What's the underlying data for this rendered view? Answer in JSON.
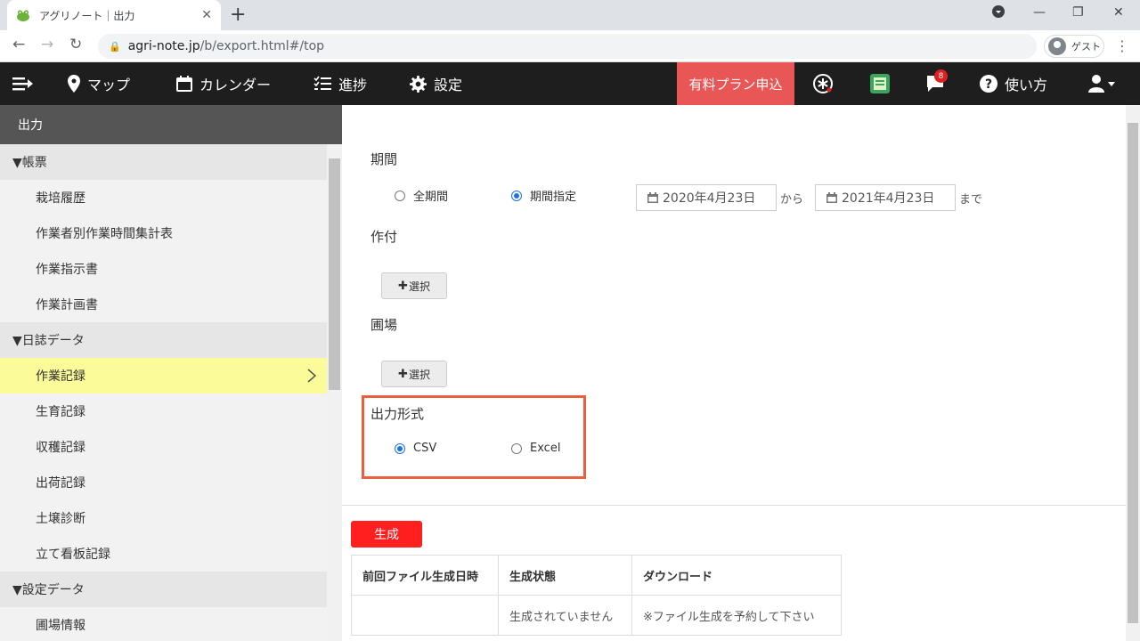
{
  "browser": {
    "tab_title": "アグリノート｜出力",
    "url_host": "agri-note.jp",
    "url_path": "/b/export.html#/top",
    "profile_label": "ゲスト"
  },
  "nav": {
    "map": "マップ",
    "calendar": "カレンダー",
    "progress": "進捗",
    "settings": "設定",
    "paid_plan": "有料プラン申込",
    "notification_count": "8",
    "help": "使い方"
  },
  "sidebar": {
    "header": "出力",
    "groups": [
      {
        "label": "▼帳票",
        "items": [
          "栽培履歴",
          "作業者別作業時間集計表",
          "作業指示書",
          "作業計画書"
        ]
      },
      {
        "label": "▼日誌データ",
        "items": [
          "作業記録",
          "生育記録",
          "収穫記録",
          "出荷記録",
          "土壌診断",
          "立て看板記録"
        ]
      },
      {
        "label": "▼設定データ",
        "items": [
          "圃場情報"
        ]
      }
    ],
    "active_item": "作業記録"
  },
  "form": {
    "period_label": "期間",
    "all_period": "全期間",
    "specified_period": "期間指定",
    "period_mode": "期間指定",
    "date_from": "2020年4月23日",
    "from_word": "から",
    "date_to": "2021年4月23日",
    "to_word": "まで",
    "crop_label": "作付",
    "field_label": "圃場",
    "select_button": "選択",
    "format_label": "出力形式",
    "format_csv": "CSV",
    "format_excel": "Excel",
    "format_selected": "CSV"
  },
  "generate": {
    "button": "生成",
    "columns": [
      "前回ファイル生成日時",
      "生成状態",
      "ダウンロード"
    ],
    "row": [
      "",
      "生成されていません",
      "※ファイル生成を予約して下さい"
    ]
  },
  "colors": {
    "nav_bg": "#1e1e1e",
    "paid_plan": "#e95656",
    "generate_button": "#ff1f1f",
    "active_item": "#fbfb9a",
    "highlight_border": "#e8603c"
  }
}
